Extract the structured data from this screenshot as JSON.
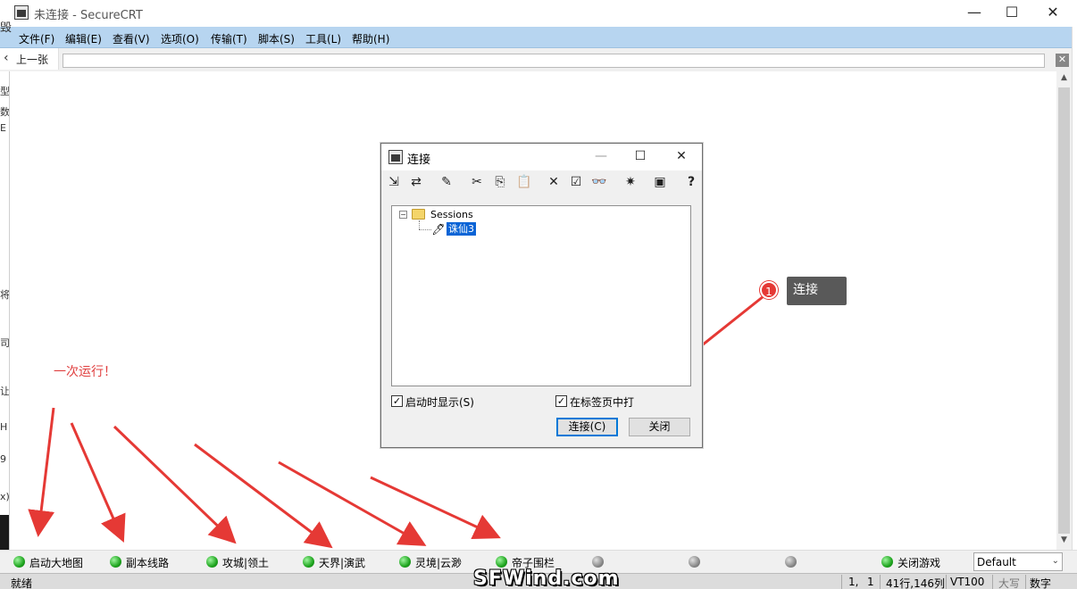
{
  "window": {
    "title": "未连接 - SecureCRT",
    "min": "—",
    "max": "☐",
    "close": "✕"
  },
  "menu": [
    "文件(F)",
    "编辑(E)",
    "查看(V)",
    "选项(O)",
    "传输(T)",
    "脚本(S)",
    "工具(L)",
    "帮助(H)"
  ],
  "nav": {
    "prev_label": "上一张",
    "prev_chevron": "‹",
    "close": "✕"
  },
  "left_edge_chars": [
    "毁",
    "型",
    "数",
    "E",
    "将",
    "司",
    "让",
    "H",
    "9",
    "x)"
  ],
  "annotation": {
    "run_once": "一次运行！",
    "callout_number": "1",
    "callout_text": "连接"
  },
  "dialog": {
    "title": "连接",
    "min": "—",
    "max": "☐",
    "close": "✕",
    "toolbar": [
      {
        "name": "quick-connect-icon",
        "glyph": "⇲"
      },
      {
        "name": "connect-in-tab-icon",
        "glyph": "⇄"
      },
      {
        "name": "new-session-icon",
        "glyph": "✎"
      },
      {
        "name": "cut-icon",
        "glyph": "✂"
      },
      {
        "name": "copy-icon",
        "glyph": "⎘"
      },
      {
        "name": "paste-icon",
        "glyph": "📋"
      },
      {
        "name": "delete-icon",
        "glyph": "✕"
      },
      {
        "name": "properties-icon",
        "glyph": "☑"
      },
      {
        "name": "find-icon",
        "glyph": "👓"
      },
      {
        "name": "new-folder-icon",
        "glyph": "✷"
      },
      {
        "name": "session-manager-icon",
        "glyph": "▣"
      },
      {
        "name": "help-icon",
        "glyph": "?"
      }
    ],
    "tree": {
      "expander": "−",
      "root": "Sessions",
      "session": "诛仙3",
      "session_icon": "🖊"
    },
    "checks": [
      {
        "label": "启动时显示(S)",
        "checked": "✓"
      },
      {
        "label": "在标签页中打",
        "checked": "✓"
      }
    ],
    "connect_button": "连接(C)",
    "close_button": "关闭"
  },
  "buttonbar": {
    "items": [
      {
        "label": "启动大地图",
        "state": "on"
      },
      {
        "label": "副本线路",
        "state": "on"
      },
      {
        "label": "攻城|领土",
        "state": "on"
      },
      {
        "label": "天界|演武",
        "state": "on"
      },
      {
        "label": "灵境|云渺",
        "state": "on"
      },
      {
        "label": "帝子围栏",
        "state": "on"
      },
      {
        "label": "",
        "state": "off"
      },
      {
        "label": "",
        "state": "off"
      },
      {
        "label": "",
        "state": "off"
      },
      {
        "label": "关闭游戏",
        "state": "on"
      }
    ],
    "session_select": "Default",
    "caret": "⌄"
  },
  "statusbar": {
    "ready": "就绪",
    "pos": "1,",
    "pos2": "1",
    "size": "41行,146列",
    "term": "VT100",
    "caps": "大写",
    "num": "数字"
  },
  "scroll": {
    "up": "▲",
    "down": "▼"
  },
  "watermark": "SFWind.com",
  "colors": {
    "menu_bg": "#b7d5f0",
    "annotation_red": "#e04040",
    "selection_blue": "#0a64d6"
  }
}
